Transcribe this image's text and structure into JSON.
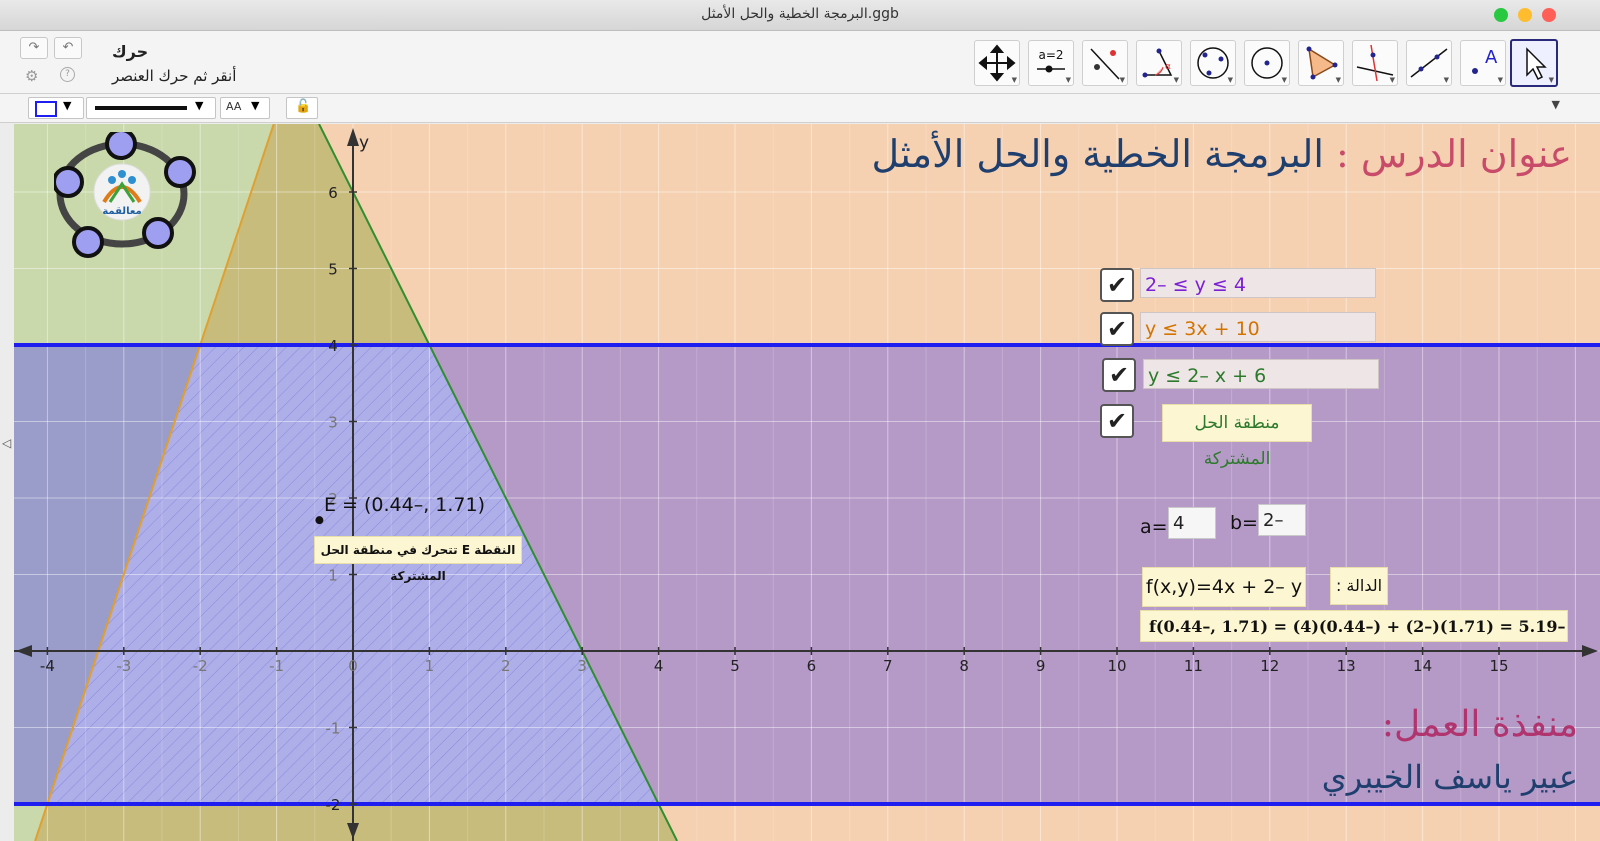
{
  "window": {
    "title": "البرمجة الخطية والحل الأمثل.ggb"
  },
  "colors": {
    "close": "#ff5f57",
    "minimize": "#febc2e",
    "zoom": "#28c840",
    "region_top": "#f6d1b1",
    "region_left": "#c9d9ab",
    "region_common": "#b59ac8",
    "blue_line": "#1e1ef0",
    "green_line": "#2f8f2f",
    "orange_line": "#e0a030",
    "inequality1": "#7b1fd6",
    "inequality2": "#d47400",
    "inequality3": "#2d7a2d",
    "title_red": "#c84b6a",
    "title_navy": "#1f3f6e",
    "work_magenta": "#b0356e"
  },
  "toolbar": {
    "undo_icon": "undo-icon",
    "redo_icon": "redo-icon",
    "settings_icon": "gear-icon",
    "help_icon": "help-icon",
    "tool_name": "حرك",
    "tool_help": "أنقر ثم حرك العنصر",
    "slider_tool_label": "a=2",
    "text_tool_label": "A",
    "tools": [
      "move-graphics-view",
      "slider",
      "reflect-about-line",
      "angle",
      "conic-through-points",
      "circle-center-point",
      "polygon",
      "perpendicular-line",
      "segment-line",
      "text",
      "move"
    ]
  },
  "stylebar": {
    "font_size_label": "AA"
  },
  "graph": {
    "axis_x_label": "",
    "axis_y_label": "y",
    "x_ticks": [
      "-4",
      "-3",
      "-2",
      "-1",
      "0",
      "1",
      "2",
      "3",
      "4",
      "5",
      "6",
      "7",
      "8",
      "9",
      "10",
      "11",
      "12",
      "13",
      "14",
      "15"
    ],
    "y_ticks": [
      "6",
      "5",
      "4",
      "3",
      "2",
      "1",
      "-1",
      "-2"
    ],
    "point_label": "E = (0.44–, 1.71)",
    "point_caption": "النقطة E تتحرك في منطقة الحل المشتركة"
  },
  "header": {
    "lesson_prefix": "عنوان الدرس :",
    "lesson_title": "البرمجة الخطية والحل الأمثل"
  },
  "checkboxes": [
    {
      "label": "2– ≤ y ≤ 4",
      "checked": true
    },
    {
      "label": "y ≤ 3x + 10",
      "checked": true
    },
    {
      "label": "y ≤ 2– x + 6",
      "checked": true
    },
    {
      "label": "منطقة الحل المشتركة",
      "checked": true
    }
  ],
  "check_mark": "✔",
  "params": {
    "a_label": "a=",
    "a_value": "4",
    "b_label": "b=",
    "b_value": "2–"
  },
  "function": {
    "caption": "الدالة :",
    "expression": "f(x,y)=4x + 2– y",
    "evaluation": "f(0.44–, 1.71) = (4)(0.44–) + (2–)(1.71) = 5.19–"
  },
  "footer": {
    "work_title": "منفذة العمل:",
    "author": "عبير ياسف الخيبري"
  },
  "logo": {
    "text": "معالقمة"
  }
}
